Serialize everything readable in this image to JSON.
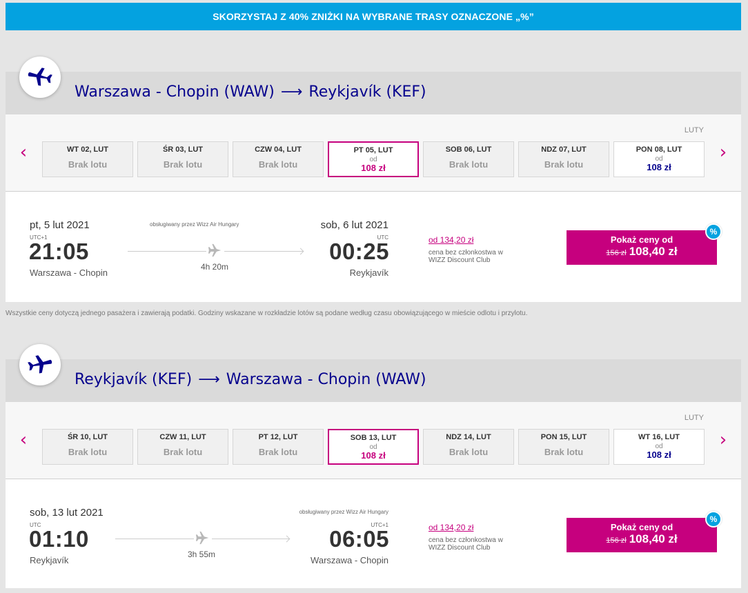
{
  "promo_banner": "SKORZYSTAJ Z 40% ZNIŻKI NA WYBRANE TRASY OZNACZONE „%”",
  "footnote": "Wszystkie ceny dotyczą jednego pasażera i zawierają podatki. Godziny wskazane w rozkładzie lotów są podane według czasu obowiązującego w mieście odlotu i przylotu.",
  "colors": {
    "brand_blue": "#04a2e0",
    "magenta": "#c6007e",
    "navy": "#06038d"
  },
  "outbound": {
    "origin": "Warszawa - Chopin (WAW)",
    "arrow": "⟶",
    "destination": "Reykjavík (KEF)",
    "month": "LUTY",
    "days": [
      {
        "label": "WT 02, LUT",
        "none": "Brak lotu"
      },
      {
        "label": "ŚR 03, LUT",
        "none": "Brak lotu"
      },
      {
        "label": "CZW 04, LUT",
        "none": "Brak lotu"
      },
      {
        "label": "PT 05, LUT",
        "from": "od",
        "price": "108 zł"
      },
      {
        "label": "SOB 06, LUT",
        "none": "Brak lotu"
      },
      {
        "label": "NDZ 07, LUT",
        "none": "Brak lotu"
      },
      {
        "label": "PON 08, LUT",
        "from": "od",
        "price": "108 zł"
      }
    ],
    "flight": {
      "dep_date": "pt, 5 lut 2021",
      "dep_tz": "UTC+1",
      "dep_time": "21:05",
      "dep_city": "Warszawa - Chopin",
      "operator": "obsługiwany przez Wizz Air Hungary",
      "duration": "4h 20m",
      "arr_date": "sob, 6 lut 2021",
      "arr_tz": "UTC",
      "arr_time": "00:25",
      "arr_city": "Reykjavík",
      "member_price": "od 134,20 zł",
      "member_note_1": "cena bez członkostwa w",
      "member_note_2": "WIZZ Discount Club",
      "button_label": "Pokaż ceny od",
      "old_price": "156 zł",
      "new_price": "108,40 zł",
      "discount_badge": "%"
    }
  },
  "return": {
    "origin": "Reykjavík (KEF)",
    "arrow": "⟶",
    "destination": "Warszawa - Chopin (WAW)",
    "month": "LUTY",
    "days": [
      {
        "label": "ŚR 10, LUT",
        "none": "Brak lotu"
      },
      {
        "label": "CZW 11, LUT",
        "none": "Brak lotu"
      },
      {
        "label": "PT 12, LUT",
        "none": "Brak lotu"
      },
      {
        "label": "SOB 13, LUT",
        "from": "od",
        "price": "108 zł"
      },
      {
        "label": "NDZ 14, LUT",
        "none": "Brak lotu"
      },
      {
        "label": "PON 15, LUT",
        "none": "Brak lotu"
      },
      {
        "label": "WT 16, LUT",
        "from": "od",
        "price": "108 zł"
      }
    ],
    "flight": {
      "dep_date": "sob, 13 lut 2021",
      "dep_tz": "UTC",
      "dep_time": "01:10",
      "dep_city": "Reykjavík",
      "operator": "obsługiwany przez Wizz Air Hungary",
      "duration": "3h 55m",
      "arr_tz": "UTC+1",
      "arr_time": "06:05",
      "arr_city": "Warszawa - Chopin",
      "member_price": "od 134,20 zł",
      "member_note_1": "cena bez członkostwa w",
      "member_note_2": "WIZZ Discount Club",
      "button_label": "Pokaż ceny od",
      "old_price": "156 zł",
      "new_price": "108,40 zł",
      "discount_badge": "%"
    }
  }
}
